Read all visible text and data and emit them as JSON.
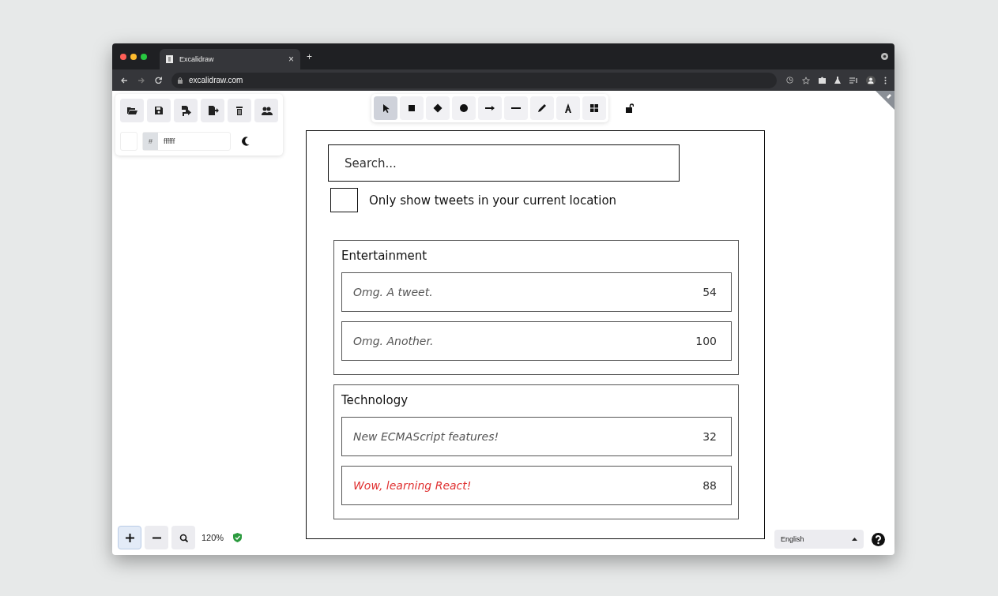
{
  "browser": {
    "tab_title": "Excalidraw",
    "close_tab": "×",
    "new_tab": "+",
    "url": "excalidraw.com"
  },
  "canvas_background": {
    "prefix": "#",
    "value": "ffffff"
  },
  "tools": [
    {
      "kind": "selection",
      "selected": true
    },
    {
      "kind": "rectangle",
      "selected": false
    },
    {
      "kind": "diamond",
      "selected": false
    },
    {
      "kind": "ellipse",
      "selected": false
    },
    {
      "kind": "arrow",
      "selected": false
    },
    {
      "kind": "line",
      "selected": false
    },
    {
      "kind": "pencil",
      "selected": false
    },
    {
      "kind": "text",
      "selected": false
    },
    {
      "kind": "library",
      "selected": false
    }
  ],
  "sketch": {
    "search": {
      "placeholder": "Search..."
    },
    "filter": {
      "checked": false,
      "label": "Only show tweets in your current location"
    },
    "categories": [
      {
        "title": "Entertainment",
        "rows": [
          {
            "text": "Omg. A tweet.",
            "count": "54",
            "color": "#555555"
          },
          {
            "text": "Omg. Another.",
            "count": "100",
            "color": "#555555"
          }
        ]
      },
      {
        "title": "Technology",
        "rows": [
          {
            "text": "New ECMAScript features!",
            "count": "32",
            "color": "#555555"
          },
          {
            "text": "Wow, learning React!",
            "count": "88",
            "color": "#e03131"
          }
        ]
      }
    ]
  },
  "zoom": {
    "level_text": "120%"
  },
  "language": {
    "value": "English"
  }
}
